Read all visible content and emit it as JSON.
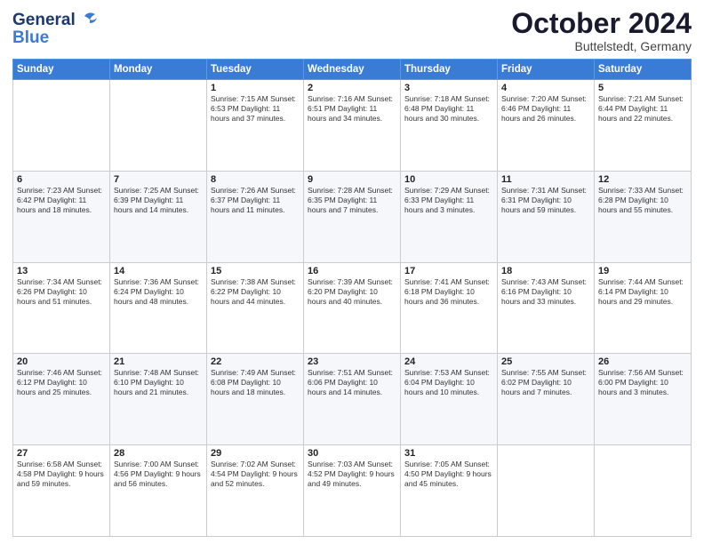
{
  "header": {
    "logo_line1": "General",
    "logo_line2": "Blue",
    "month": "October 2024",
    "location": "Buttelstedt, Germany"
  },
  "days_of_week": [
    "Sunday",
    "Monday",
    "Tuesday",
    "Wednesday",
    "Thursday",
    "Friday",
    "Saturday"
  ],
  "weeks": [
    [
      {
        "day": "",
        "detail": ""
      },
      {
        "day": "",
        "detail": ""
      },
      {
        "day": "1",
        "detail": "Sunrise: 7:15 AM\nSunset: 6:53 PM\nDaylight: 11 hours\nand 37 minutes."
      },
      {
        "day": "2",
        "detail": "Sunrise: 7:16 AM\nSunset: 6:51 PM\nDaylight: 11 hours\nand 34 minutes."
      },
      {
        "day": "3",
        "detail": "Sunrise: 7:18 AM\nSunset: 6:48 PM\nDaylight: 11 hours\nand 30 minutes."
      },
      {
        "day": "4",
        "detail": "Sunrise: 7:20 AM\nSunset: 6:46 PM\nDaylight: 11 hours\nand 26 minutes."
      },
      {
        "day": "5",
        "detail": "Sunrise: 7:21 AM\nSunset: 6:44 PM\nDaylight: 11 hours\nand 22 minutes."
      }
    ],
    [
      {
        "day": "6",
        "detail": "Sunrise: 7:23 AM\nSunset: 6:42 PM\nDaylight: 11 hours\nand 18 minutes."
      },
      {
        "day": "7",
        "detail": "Sunrise: 7:25 AM\nSunset: 6:39 PM\nDaylight: 11 hours\nand 14 minutes."
      },
      {
        "day": "8",
        "detail": "Sunrise: 7:26 AM\nSunset: 6:37 PM\nDaylight: 11 hours\nand 11 minutes."
      },
      {
        "day": "9",
        "detail": "Sunrise: 7:28 AM\nSunset: 6:35 PM\nDaylight: 11 hours\nand 7 minutes."
      },
      {
        "day": "10",
        "detail": "Sunrise: 7:29 AM\nSunset: 6:33 PM\nDaylight: 11 hours\nand 3 minutes."
      },
      {
        "day": "11",
        "detail": "Sunrise: 7:31 AM\nSunset: 6:31 PM\nDaylight: 10 hours\nand 59 minutes."
      },
      {
        "day": "12",
        "detail": "Sunrise: 7:33 AM\nSunset: 6:28 PM\nDaylight: 10 hours\nand 55 minutes."
      }
    ],
    [
      {
        "day": "13",
        "detail": "Sunrise: 7:34 AM\nSunset: 6:26 PM\nDaylight: 10 hours\nand 51 minutes."
      },
      {
        "day": "14",
        "detail": "Sunrise: 7:36 AM\nSunset: 6:24 PM\nDaylight: 10 hours\nand 48 minutes."
      },
      {
        "day": "15",
        "detail": "Sunrise: 7:38 AM\nSunset: 6:22 PM\nDaylight: 10 hours\nand 44 minutes."
      },
      {
        "day": "16",
        "detail": "Sunrise: 7:39 AM\nSunset: 6:20 PM\nDaylight: 10 hours\nand 40 minutes."
      },
      {
        "day": "17",
        "detail": "Sunrise: 7:41 AM\nSunset: 6:18 PM\nDaylight: 10 hours\nand 36 minutes."
      },
      {
        "day": "18",
        "detail": "Sunrise: 7:43 AM\nSunset: 6:16 PM\nDaylight: 10 hours\nand 33 minutes."
      },
      {
        "day": "19",
        "detail": "Sunrise: 7:44 AM\nSunset: 6:14 PM\nDaylight: 10 hours\nand 29 minutes."
      }
    ],
    [
      {
        "day": "20",
        "detail": "Sunrise: 7:46 AM\nSunset: 6:12 PM\nDaylight: 10 hours\nand 25 minutes."
      },
      {
        "day": "21",
        "detail": "Sunrise: 7:48 AM\nSunset: 6:10 PM\nDaylight: 10 hours\nand 21 minutes."
      },
      {
        "day": "22",
        "detail": "Sunrise: 7:49 AM\nSunset: 6:08 PM\nDaylight: 10 hours\nand 18 minutes."
      },
      {
        "day": "23",
        "detail": "Sunrise: 7:51 AM\nSunset: 6:06 PM\nDaylight: 10 hours\nand 14 minutes."
      },
      {
        "day": "24",
        "detail": "Sunrise: 7:53 AM\nSunset: 6:04 PM\nDaylight: 10 hours\nand 10 minutes."
      },
      {
        "day": "25",
        "detail": "Sunrise: 7:55 AM\nSunset: 6:02 PM\nDaylight: 10 hours\nand 7 minutes."
      },
      {
        "day": "26",
        "detail": "Sunrise: 7:56 AM\nSunset: 6:00 PM\nDaylight: 10 hours\nand 3 minutes."
      }
    ],
    [
      {
        "day": "27",
        "detail": "Sunrise: 6:58 AM\nSunset: 4:58 PM\nDaylight: 9 hours\nand 59 minutes."
      },
      {
        "day": "28",
        "detail": "Sunrise: 7:00 AM\nSunset: 4:56 PM\nDaylight: 9 hours\nand 56 minutes."
      },
      {
        "day": "29",
        "detail": "Sunrise: 7:02 AM\nSunset: 4:54 PM\nDaylight: 9 hours\nand 52 minutes."
      },
      {
        "day": "30",
        "detail": "Sunrise: 7:03 AM\nSunset: 4:52 PM\nDaylight: 9 hours\nand 49 minutes."
      },
      {
        "day": "31",
        "detail": "Sunrise: 7:05 AM\nSunset: 4:50 PM\nDaylight: 9 hours\nand 45 minutes."
      },
      {
        "day": "",
        "detail": ""
      },
      {
        "day": "",
        "detail": ""
      }
    ]
  ]
}
